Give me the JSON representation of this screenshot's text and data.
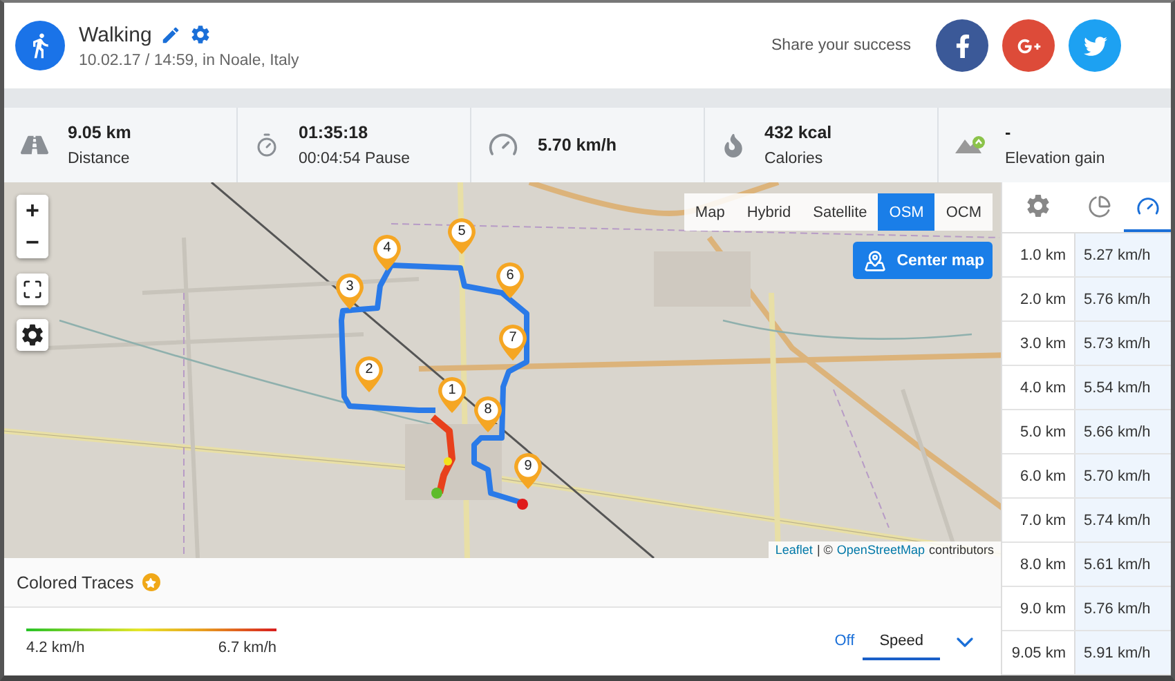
{
  "activity": {
    "title": "Walking",
    "subtitle": "10.02.17 / 14:59, in Noale, Italy"
  },
  "share": {
    "label": "Share your success",
    "networks": [
      {
        "kind": "facebook"
      },
      {
        "kind": "google"
      },
      {
        "kind": "twitter"
      }
    ]
  },
  "stats": [
    {
      "kind": "distance",
      "value": "9.05 km",
      "label": "Distance"
    },
    {
      "kind": "time",
      "value": "01:35:18",
      "label": "00:04:54 Pause"
    },
    {
      "kind": "speed",
      "value": "5.70 km/h"
    },
    {
      "kind": "calories",
      "value": "432 kcal",
      "label": "Calories"
    },
    {
      "kind": "elevation",
      "value": "-",
      "label": "Elevation gain"
    }
  ],
  "map": {
    "layers": [
      {
        "label": "Map",
        "selected": false
      },
      {
        "label": "Hybrid",
        "selected": false
      },
      {
        "label": "Satellite",
        "selected": false
      },
      {
        "label": "OSM",
        "selected": true
      },
      {
        "label": "OCM",
        "selected": false
      }
    ],
    "center_button": "Center map",
    "zoom_in": "+",
    "zoom_out": "−",
    "markers": [
      "1",
      "2",
      "3",
      "4",
      "5",
      "6",
      "7",
      "8",
      "9"
    ],
    "attribution": {
      "link": "Leaflet",
      "separator": "| ©",
      "source": "OpenStreetMap",
      "suffix": "contributors"
    }
  },
  "splits": {
    "tabs": [
      {
        "kind": "settings",
        "selected": false
      },
      {
        "kind": "pace",
        "selected": false
      },
      {
        "kind": "speed",
        "selected": true
      }
    ],
    "rows": [
      {
        "distance": "1.0 km",
        "speed": "5.27 km/h"
      },
      {
        "distance": "2.0 km",
        "speed": "5.76 km/h"
      },
      {
        "distance": "3.0 km",
        "speed": "5.73 km/h"
      },
      {
        "distance": "4.0 km",
        "speed": "5.54 km/h"
      },
      {
        "distance": "5.0 km",
        "speed": "5.66 km/h"
      },
      {
        "distance": "6.0 km",
        "speed": "5.70 km/h"
      },
      {
        "distance": "7.0 km",
        "speed": "5.74 km/h"
      },
      {
        "distance": "8.0 km",
        "speed": "5.61 km/h"
      },
      {
        "distance": "9.0 km",
        "speed": "5.76 km/h"
      },
      {
        "distance": "9.05 km",
        "speed": "5.91 km/h"
      }
    ]
  },
  "traces": {
    "title": "Colored Traces",
    "legend_min": "4.2 km/h",
    "legend_max": "6.7 km/h",
    "modes": [
      {
        "label": "Off",
        "selected": false
      },
      {
        "label": "Speed",
        "selected": true
      }
    ]
  }
}
